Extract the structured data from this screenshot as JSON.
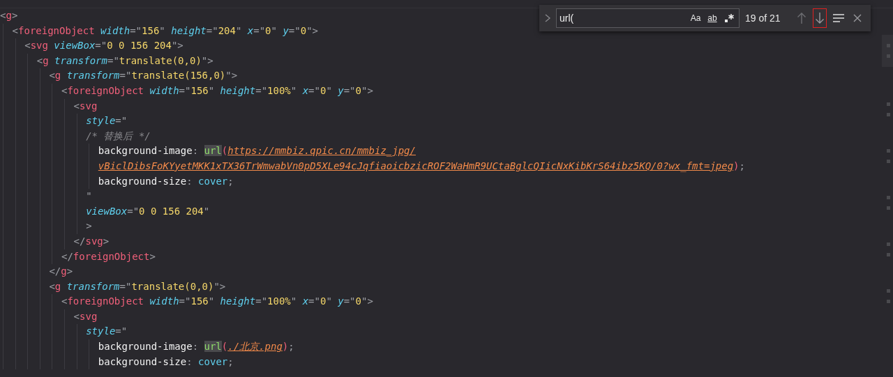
{
  "code": [
    {
      "tokens": [
        {
          "kind": "punct",
          "text": "<"
        },
        {
          "kind": "tag",
          "text": "g"
        },
        {
          "kind": "punct",
          "text": ">"
        }
      ],
      "children": [
        {
          "tokens": [
            {
              "kind": "punct",
              "text": "<"
            },
            {
              "kind": "tag",
              "text": "foreignObject"
            },
            {
              "kind": "attr",
              "text": " width"
            },
            {
              "kind": "punct",
              "text": "=\""
            },
            {
              "kind": "value",
              "text": "156"
            },
            {
              "kind": "punct",
              "text": "\""
            },
            {
              "kind": "attr",
              "text": " height"
            },
            {
              "kind": "punct",
              "text": "=\""
            },
            {
              "kind": "value",
              "text": "204"
            },
            {
              "kind": "punct",
              "text": "\""
            },
            {
              "kind": "attr",
              "text": " x"
            },
            {
              "kind": "punct",
              "text": "=\""
            },
            {
              "kind": "value",
              "text": "0"
            },
            {
              "kind": "punct",
              "text": "\""
            },
            {
              "kind": "attr",
              "text": " y"
            },
            {
              "kind": "punct",
              "text": "=\""
            },
            {
              "kind": "value",
              "text": "0"
            },
            {
              "kind": "punct",
              "text": "\">"
            }
          ],
          "children": [
            {
              "tokens": [
                {
                  "kind": "punct",
                  "text": "<"
                },
                {
                  "kind": "tag",
                  "text": "svg"
                },
                {
                  "kind": "attr",
                  "text": " viewBox"
                },
                {
                  "kind": "punct",
                  "text": "=\""
                },
                {
                  "kind": "value",
                  "text": "0 0 156 204"
                },
                {
                  "kind": "punct",
                  "text": "\">"
                }
              ],
              "children": [
                {
                  "tokens": [
                    {
                      "kind": "punct",
                      "text": "<"
                    },
                    {
                      "kind": "tag",
                      "text": "g"
                    },
                    {
                      "kind": "attr",
                      "text": " transform"
                    },
                    {
                      "kind": "punct",
                      "text": "=\""
                    },
                    {
                      "kind": "value",
                      "text": "translate(0,0)"
                    },
                    {
                      "kind": "punct",
                      "text": "\">"
                    }
                  ],
                  "children": [
                    {
                      "tokens": [
                        {
                          "kind": "punct",
                          "text": "<"
                        },
                        {
                          "kind": "tag",
                          "text": "g"
                        },
                        {
                          "kind": "attr",
                          "text": " transform"
                        },
                        {
                          "kind": "punct",
                          "text": "=\""
                        },
                        {
                          "kind": "value",
                          "text": "translate(156,0)"
                        },
                        {
                          "kind": "punct",
                          "text": "\">"
                        }
                      ],
                      "children": [
                        {
                          "tokens": [
                            {
                              "kind": "punct",
                              "text": "<"
                            },
                            {
                              "kind": "tag",
                              "text": "foreignObject"
                            },
                            {
                              "kind": "attr",
                              "text": " width"
                            },
                            {
                              "kind": "punct",
                              "text": "=\""
                            },
                            {
                              "kind": "value",
                              "text": "156"
                            },
                            {
                              "kind": "punct",
                              "text": "\""
                            },
                            {
                              "kind": "attr",
                              "text": " height"
                            },
                            {
                              "kind": "punct",
                              "text": "=\""
                            },
                            {
                              "kind": "value",
                              "text": "100%"
                            },
                            {
                              "kind": "punct",
                              "text": "\""
                            },
                            {
                              "kind": "attr",
                              "text": " x"
                            },
                            {
                              "kind": "punct",
                              "text": "=\""
                            },
                            {
                              "kind": "value",
                              "text": "0"
                            },
                            {
                              "kind": "punct",
                              "text": "\""
                            },
                            {
                              "kind": "attr",
                              "text": " y"
                            },
                            {
                              "kind": "punct",
                              "text": "=\""
                            },
                            {
                              "kind": "value",
                              "text": "0"
                            },
                            {
                              "kind": "punct",
                              "text": "\">"
                            }
                          ],
                          "children": [
                            {
                              "tokens": [
                                {
                                  "kind": "punct",
                                  "text": "<"
                                },
                                {
                                  "kind": "tag",
                                  "text": "svg"
                                }
                              ],
                              "children": [
                                {
                                  "tokens": [
                                    {
                                      "kind": "attr",
                                      "text": "style"
                                    },
                                    {
                                      "kind": "punct",
                                      "text": "=\""
                                    }
                                  ]
                                },
                                {
                                  "tokens": [
                                    {
                                      "kind": "comment",
                                      "text": "/* 替换后 */"
                                    }
                                  ],
                                  "children": [
                                    {
                                      "tokens": [
                                        {
                                          "kind": "prop",
                                          "text": "background-image"
                                        },
                                        {
                                          "kind": "punct",
                                          "text": ": "
                                        },
                                        {
                                          "kind": "match",
                                          "text": "url"
                                        },
                                        {
                                          "kind": "paren",
                                          "text": "("
                                        },
                                        {
                                          "kind": "link",
                                          "text": "https://mmbiz.qpic.cn/mmbiz_jpg/"
                                        }
                                      ]
                                    },
                                    {
                                      "tokens": [
                                        {
                                          "kind": "link",
                                          "text": "vBiclDibsFoKYyetMKK1xTX36TrWmwabVn0pD5XLe94cJqfiaoicbzicROF2WaHmR9UCtaBglcQIicNxKibKrS64ibz5KQ/0?wx_fmt=jpeg"
                                        },
                                        {
                                          "kind": "paren",
                                          "text": ")"
                                        },
                                        {
                                          "kind": "punct",
                                          "text": ";"
                                        }
                                      ]
                                    },
                                    {
                                      "tokens": [
                                        {
                                          "kind": "prop",
                                          "text": "background-size"
                                        },
                                        {
                                          "kind": "punct",
                                          "text": ": "
                                        },
                                        {
                                          "kind": "keyword",
                                          "text": "cover"
                                        },
                                        {
                                          "kind": "punct",
                                          "text": ";"
                                        }
                                      ]
                                    }
                                  ]
                                },
                                {
                                  "tokens": [
                                    {
                                      "kind": "punct",
                                      "text": "\""
                                    }
                                  ]
                                },
                                {
                                  "tokens": [
                                    {
                                      "kind": "attr",
                                      "text": "viewBox"
                                    },
                                    {
                                      "kind": "punct",
                                      "text": "=\""
                                    },
                                    {
                                      "kind": "value",
                                      "text": "0 0 156 204"
                                    },
                                    {
                                      "kind": "punct",
                                      "text": "\""
                                    }
                                  ]
                                },
                                {
                                  "tokens": [
                                    {
                                      "kind": "punct",
                                      "text": ">"
                                    }
                                  ]
                                }
                              ]
                            },
                            {
                              "tokens": [
                                {
                                  "kind": "punct",
                                  "text": "</"
                                },
                                {
                                  "kind": "tag",
                                  "text": "svg"
                                },
                                {
                                  "kind": "punct",
                                  "text": ">"
                                }
                              ]
                            }
                          ]
                        },
                        {
                          "tokens": [
                            {
                              "kind": "punct",
                              "text": "</"
                            },
                            {
                              "kind": "tag",
                              "text": "foreignObject"
                            },
                            {
                              "kind": "punct",
                              "text": ">"
                            }
                          ]
                        }
                      ]
                    },
                    {
                      "tokens": [
                        {
                          "kind": "punct",
                          "text": "</"
                        },
                        {
                          "kind": "tag",
                          "text": "g"
                        },
                        {
                          "kind": "punct",
                          "text": ">"
                        }
                      ]
                    },
                    {
                      "tokens": [
                        {
                          "kind": "punct",
                          "text": "<"
                        },
                        {
                          "kind": "tag",
                          "text": "g"
                        },
                        {
                          "kind": "attr",
                          "text": " transform"
                        },
                        {
                          "kind": "punct",
                          "text": "=\""
                        },
                        {
                          "kind": "value",
                          "text": "translate(0,0)"
                        },
                        {
                          "kind": "punct",
                          "text": "\">"
                        }
                      ],
                      "children": [
                        {
                          "tokens": [
                            {
                              "kind": "punct",
                              "text": "<"
                            },
                            {
                              "kind": "tag",
                              "text": "foreignObject"
                            },
                            {
                              "kind": "attr",
                              "text": " width"
                            },
                            {
                              "kind": "punct",
                              "text": "=\""
                            },
                            {
                              "kind": "value",
                              "text": "156"
                            },
                            {
                              "kind": "punct",
                              "text": "\""
                            },
                            {
                              "kind": "attr",
                              "text": " height"
                            },
                            {
                              "kind": "punct",
                              "text": "=\""
                            },
                            {
                              "kind": "value",
                              "text": "100%"
                            },
                            {
                              "kind": "punct",
                              "text": "\""
                            },
                            {
                              "kind": "attr",
                              "text": " x"
                            },
                            {
                              "kind": "punct",
                              "text": "=\""
                            },
                            {
                              "kind": "value",
                              "text": "0"
                            },
                            {
                              "kind": "punct",
                              "text": "\""
                            },
                            {
                              "kind": "attr",
                              "text": " y"
                            },
                            {
                              "kind": "punct",
                              "text": "=\""
                            },
                            {
                              "kind": "value",
                              "text": "0"
                            },
                            {
                              "kind": "punct",
                              "text": "\">"
                            }
                          ],
                          "children": [
                            {
                              "tokens": [
                                {
                                  "kind": "punct",
                                  "text": "<"
                                },
                                {
                                  "kind": "tag",
                                  "text": "svg"
                                }
                              ],
                              "children": [
                                {
                                  "tokens": [
                                    {
                                      "kind": "attr",
                                      "text": "style"
                                    },
                                    {
                                      "kind": "punct",
                                      "text": "=\""
                                    }
                                  ],
                                  "children": [
                                    {
                                      "tokens": [
                                        {
                                          "kind": "prop",
                                          "text": "background-image"
                                        },
                                        {
                                          "kind": "punct",
                                          "text": ": "
                                        },
                                        {
                                          "kind": "match",
                                          "text": "url"
                                        },
                                        {
                                          "kind": "paren",
                                          "text": "("
                                        },
                                        {
                                          "kind": "link",
                                          "text": "./北京.png"
                                        },
                                        {
                                          "kind": "paren",
                                          "text": ")"
                                        },
                                        {
                                          "kind": "punct",
                                          "text": ";"
                                        }
                                      ]
                                    },
                                    {
                                      "tokens": [
                                        {
                                          "kind": "prop",
                                          "text": "background-size"
                                        },
                                        {
                                          "kind": "punct",
                                          "text": ": "
                                        },
                                        {
                                          "kind": "keyword",
                                          "text": "cover"
                                        },
                                        {
                                          "kind": "punct",
                                          "text": ";"
                                        }
                                      ]
                                    }
                                  ]
                                }
                              ]
                            }
                          ]
                        }
                      ]
                    }
                  ]
                }
              ]
            }
          ]
        }
      ]
    }
  ],
  "find": {
    "value": "url(",
    "toggles": [
      {
        "kind": "case",
        "label": "Aa",
        "on": false
      },
      {
        "kind": "word",
        "label": "ab",
        "on": false
      },
      {
        "kind": "regex",
        "on": false
      }
    ],
    "count": "19 of 21",
    "nav": [
      {
        "kind": "up",
        "focused": false
      },
      {
        "kind": "down",
        "focused": true
      }
    ]
  }
}
